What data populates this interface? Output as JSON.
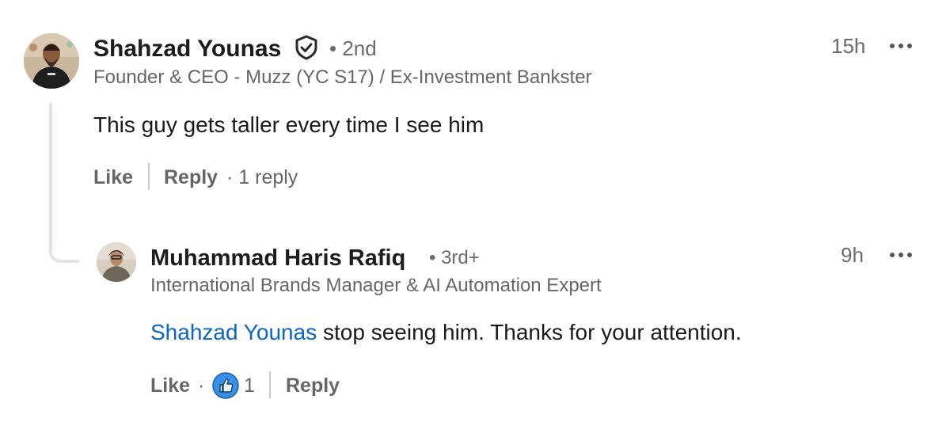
{
  "comment": {
    "author_name": "Shahzad Younas",
    "degree": "• 2nd",
    "headline": "Founder & CEO - Muzz (YC S17) / Ex-Investment Bankster",
    "time": "15h",
    "text": "This guy gets taller every time I see him",
    "actions": {
      "like_label": "Like",
      "reply_label": "Reply",
      "replies_count": "· 1 reply"
    },
    "avatar_icon": "person-avatar",
    "verified_icon": "shield-check-icon"
  },
  "reply": {
    "author_name": "Muhammad Haris Rafiq",
    "degree": "• 3rd+",
    "headline": "International Brands Manager & AI Automation Expert",
    "time": "9h",
    "mention": "Shahzad Younas",
    "text": " stop seeing him. Thanks for your attention.",
    "actions": {
      "like_label": "Like",
      "dot": "·",
      "reaction_count": "1",
      "reply_label": "Reply"
    },
    "reaction_icon": "like-thumbs-up-icon"
  },
  "colors": {
    "mention": "#0a66c2",
    "thread_line": "#e3e3e3",
    "reaction_blue": "#378fe9"
  }
}
